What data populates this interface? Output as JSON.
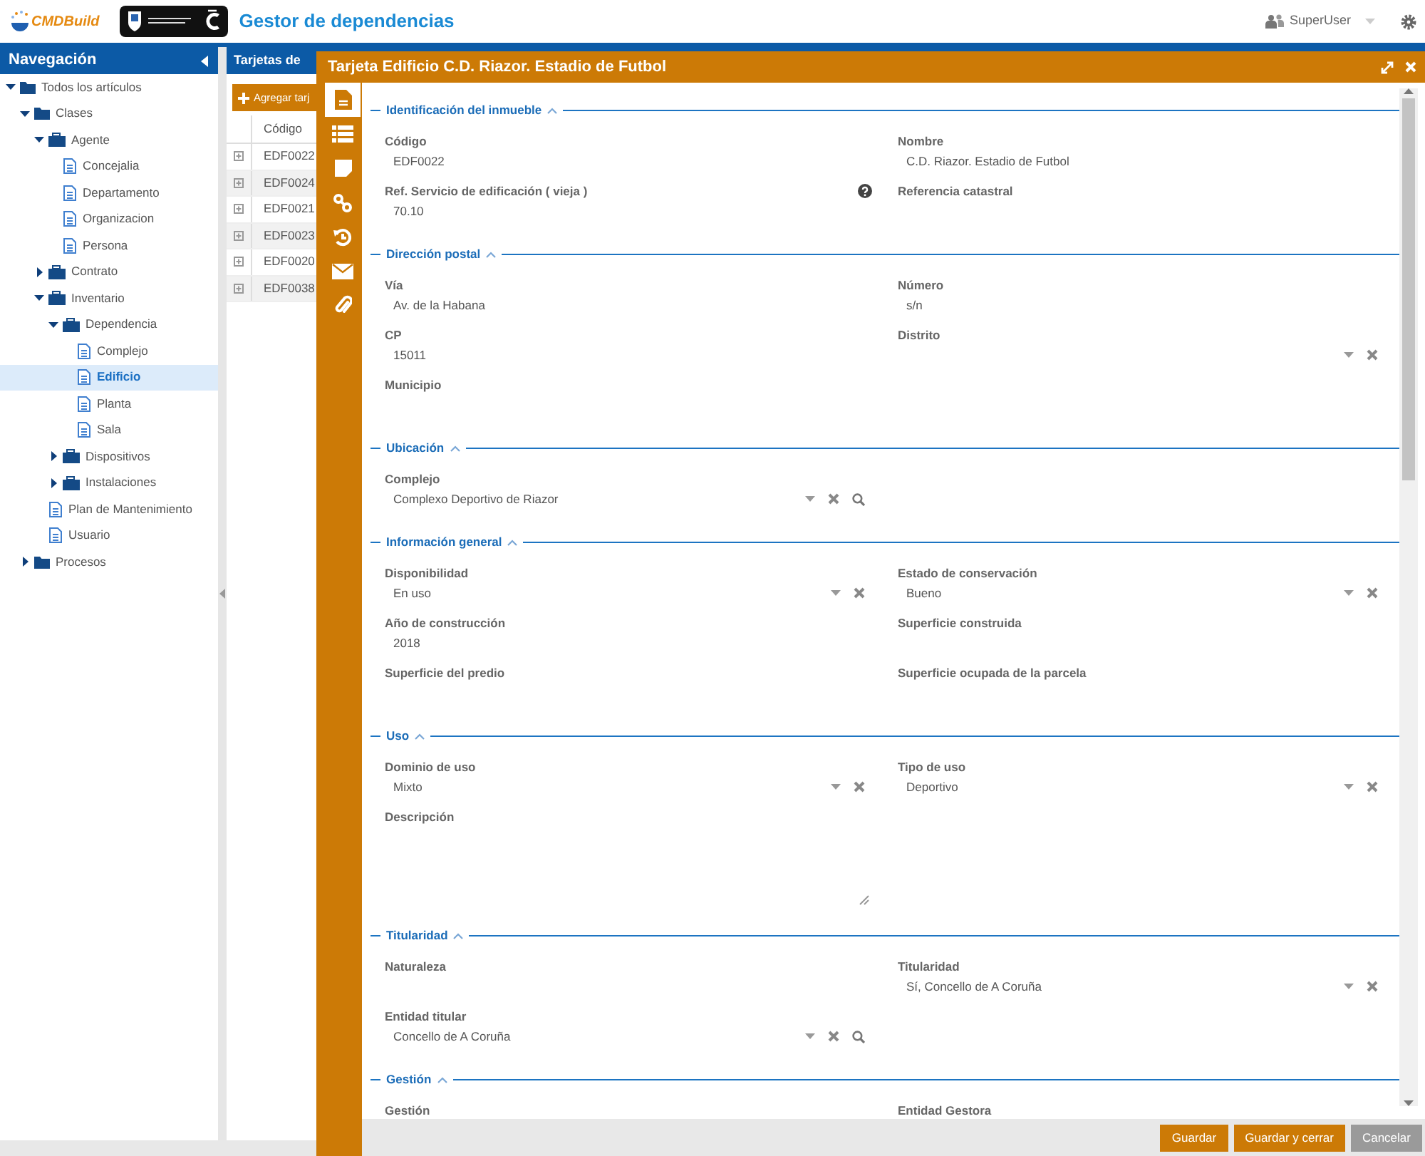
{
  "app": {
    "logo_text": "CMDBuild",
    "title": "Gestor de dependencias",
    "user": "SuperUser"
  },
  "navigation": {
    "title": "Navegación",
    "tree": [
      {
        "label": "Todos los artículos",
        "kind": "folder",
        "expanded": true,
        "selected": false,
        "children": [
          {
            "label": "Clases",
            "kind": "folder",
            "expanded": true,
            "selected": false,
            "children": [
              {
                "label": "Agente",
                "kind": "superclass",
                "expanded": true,
                "selected": false,
                "children": [
                  {
                    "label": "Concejalia",
                    "kind": "class",
                    "selected": false
                  },
                  {
                    "label": "Departamento",
                    "kind": "class",
                    "selected": false
                  },
                  {
                    "label": "Organizacion",
                    "kind": "class",
                    "selected": false
                  },
                  {
                    "label": "Persona",
                    "kind": "class",
                    "selected": false
                  }
                ]
              },
              {
                "label": "Contrato",
                "kind": "superclass",
                "expanded": false,
                "selected": false
              },
              {
                "label": "Inventario",
                "kind": "superclass",
                "expanded": true,
                "selected": false,
                "children": [
                  {
                    "label": "Dependencia",
                    "kind": "superclass",
                    "expanded": true,
                    "selected": false,
                    "children": [
                      {
                        "label": "Complejo",
                        "kind": "class",
                        "selected": false
                      },
                      {
                        "label": "Edificio",
                        "kind": "class",
                        "selected": true
                      },
                      {
                        "label": "Planta",
                        "kind": "class",
                        "selected": false
                      },
                      {
                        "label": "Sala",
                        "kind": "class",
                        "selected": false
                      }
                    ]
                  },
                  {
                    "label": "Dispositivos",
                    "kind": "superclass",
                    "expanded": false,
                    "selected": false
                  },
                  {
                    "label": "Instalaciones",
                    "kind": "superclass",
                    "expanded": false,
                    "selected": false
                  }
                ]
              },
              {
                "label": "Plan de Mantenimiento",
                "kind": "class",
                "selected": false
              },
              {
                "label": "Usuario",
                "kind": "class",
                "selected": false
              }
            ]
          },
          {
            "label": "Procesos",
            "kind": "folder",
            "expanded": false,
            "selected": false
          }
        ]
      }
    ]
  },
  "cards_panel": {
    "title": "Tarjetas de",
    "add_button": "Agregar tarj",
    "columns": [
      "Código"
    ],
    "rows": [
      {
        "code": "EDF0022"
      },
      {
        "code": "EDF0024"
      },
      {
        "code": "EDF0021"
      },
      {
        "code": "EDF0023"
      },
      {
        "code": "EDF0020"
      },
      {
        "code": "EDF0038"
      }
    ]
  },
  "card_window": {
    "title": "Tarjeta Edificio C.D. Riazor. Estadio de Futbol",
    "tabs": [
      {
        "kind": "card",
        "selected": true
      },
      {
        "kind": "details",
        "selected": false
      },
      {
        "kind": "notes",
        "selected": false
      },
      {
        "kind": "relations",
        "selected": false
      },
      {
        "kind": "history",
        "selected": false
      },
      {
        "kind": "email",
        "selected": false
      },
      {
        "kind": "attachments",
        "selected": false
      }
    ],
    "sections": [
      {
        "title": "Identificación del inmueble",
        "expanded": true,
        "rows": [
          {
            "left": {
              "label": "Código",
              "kind": "text",
              "value": "EDF0022"
            },
            "right": {
              "label": "Nombre",
              "kind": "text",
              "value": "C.D. Riazor. Estadio de Futbol"
            }
          },
          {
            "left": {
              "label": "Ref. Servicio de edificación ( vieja )",
              "kind": "text",
              "value": "70.10",
              "help": true
            },
            "right": {
              "label": "Referencia catastral",
              "kind": "text"
            }
          }
        ]
      },
      {
        "title": "Dirección postal",
        "expanded": true,
        "rows": [
          {
            "left": {
              "label": "Vía",
              "kind": "text",
              "value": "Av. de la Habana"
            },
            "right": {
              "label": "Número",
              "kind": "text",
              "value": "s/n"
            }
          },
          {
            "left": {
              "label": "CP",
              "kind": "text",
              "value": "15011"
            },
            "right": {
              "label": "Distrito",
              "kind": "combo"
            }
          },
          {
            "left": {
              "label": "Municipio",
              "kind": "text"
            }
          }
        ]
      },
      {
        "title": "Ubicación",
        "expanded": true,
        "rows": [
          {
            "left": {
              "label": "Complejo",
              "kind": "lookup",
              "value": "Complexo Deportivo de Riazor"
            }
          }
        ]
      },
      {
        "title": "Información general",
        "expanded": true,
        "rows": [
          {
            "left": {
              "label": "Disponibilidad",
              "kind": "combo",
              "value": "En uso"
            },
            "right": {
              "label": "Estado de conservación",
              "kind": "combo",
              "value": "Bueno"
            }
          },
          {
            "left": {
              "label": "Año de construcción",
              "kind": "text",
              "value": "2018"
            },
            "right": {
              "label": "Superficie construida",
              "kind": "text"
            }
          },
          {
            "left": {
              "label": "Superficie del predio",
              "kind": "text"
            },
            "right": {
              "label": "Superficie ocupada de la parcela",
              "kind": "text"
            }
          }
        ]
      },
      {
        "title": "Uso",
        "expanded": true,
        "rows": [
          {
            "left": {
              "label": "Dominio de uso",
              "kind": "combo",
              "value": "Mixto"
            },
            "right": {
              "label": "Tipo de uso",
              "kind": "combo",
              "value": "Deportivo"
            }
          },
          {
            "left": {
              "label": "Descripción",
              "kind": "textarea"
            }
          }
        ]
      },
      {
        "title": "Titularidad",
        "expanded": true,
        "rows": [
          {
            "left": {
              "label": "Naturaleza",
              "kind": "text"
            },
            "right": {
              "label": "Titularidad",
              "kind": "combo",
              "value": "Sí, Concello de A Coruña"
            }
          },
          {
            "left": {
              "label": "Entidad titular",
              "kind": "lookup",
              "value": "Concello de A Coruña"
            }
          }
        ]
      },
      {
        "title": "Gestión",
        "expanded": true,
        "rows": [
          {
            "left": {
              "label": "Gestión",
              "kind": "text"
            },
            "right": {
              "label": "Entidad Gestora",
              "kind": "text"
            }
          }
        ]
      }
    ],
    "buttons": [
      {
        "label": "Guardar",
        "kind": "primary"
      },
      {
        "label": "Guardar y cerrar",
        "kind": "primary"
      },
      {
        "label": "Cancelar",
        "kind": "secondary"
      }
    ]
  }
}
